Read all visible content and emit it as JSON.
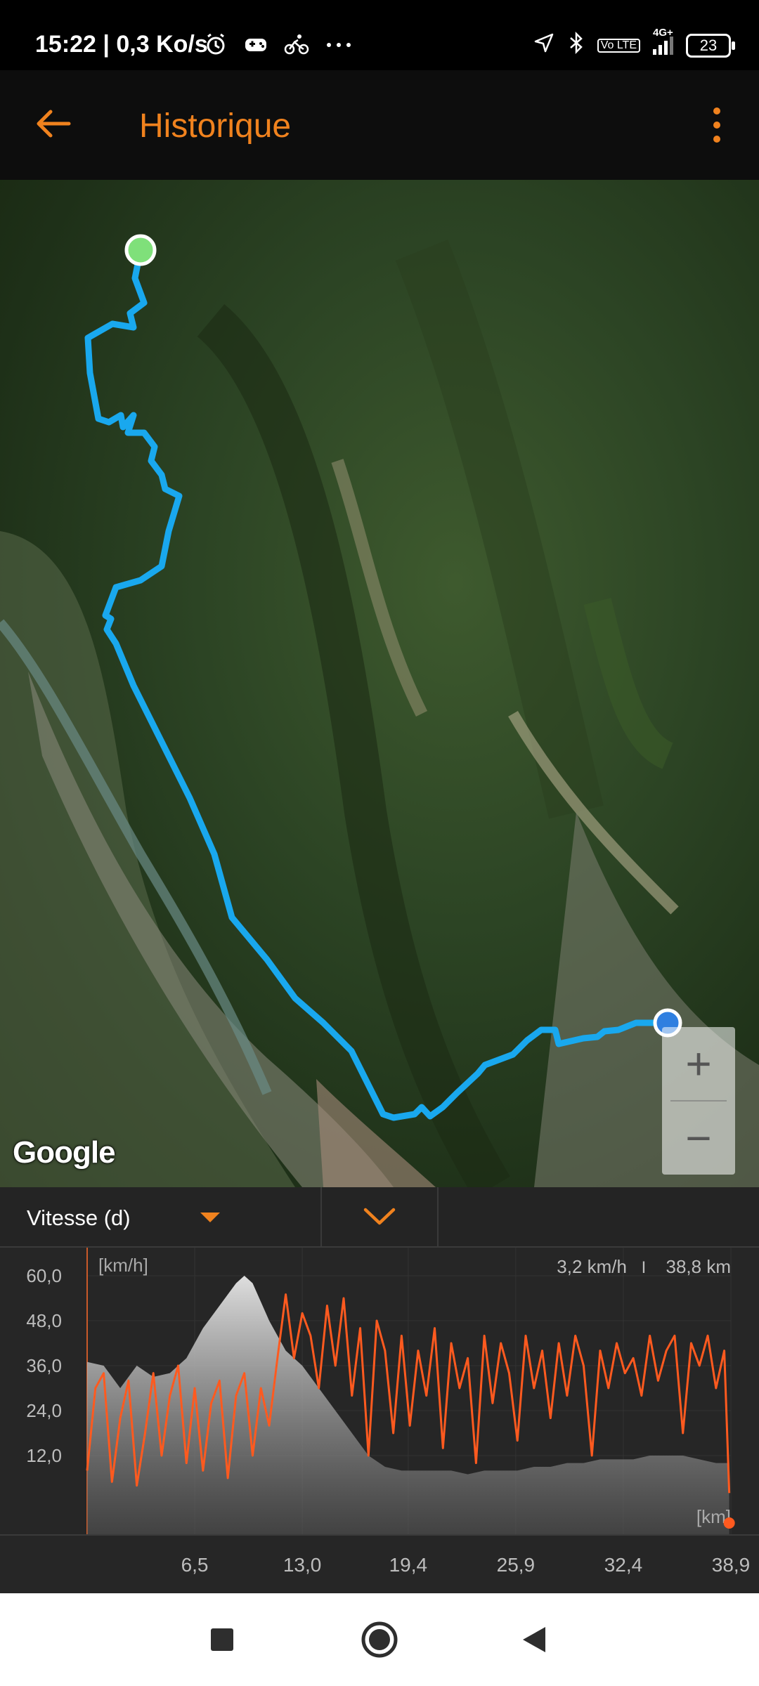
{
  "status_bar": {
    "time": "15:22 | 0,3 Ko/s",
    "network": "4G+",
    "volte": "Vo LTE",
    "battery": "23",
    "icons_left": [
      "alarm-icon",
      "gamepad-icon",
      "cycling-icon",
      "more-dots-icon"
    ],
    "icons_right": [
      "location-arrow-icon",
      "bluetooth-icon",
      "volte-icon",
      "signal-icon",
      "battery-icon"
    ]
  },
  "appbar": {
    "title": "Historique",
    "accent_color": "#f0821e"
  },
  "map": {
    "attribution": "Google",
    "route_color": "#19a8ee",
    "start_marker_color": "#7fe07a",
    "end_marker_color": "#2f7fe0",
    "zoom_in": "+",
    "zoom_out": "−"
  },
  "selector": {
    "metric": "Vitesse (d)"
  },
  "chart_data": {
    "type": "line",
    "ylabel": "[km/h]",
    "xlabel": "[km]",
    "summary_speed": "3,2 km/h",
    "summary_sep": "I",
    "summary_distance": "38,8 km",
    "yticks": [
      "60,0",
      "48,0",
      "36,0",
      "24,0",
      "12,0"
    ],
    "xticks": [
      "6,5",
      "13,0",
      "19,4",
      "25,9",
      "32,4",
      "38,9"
    ],
    "xlim": [
      0,
      38.9
    ],
    "ylim": [
      0,
      60
    ],
    "series": [
      {
        "name": "Vitesse",
        "color": "#ff5a1f",
        "x": [
          0,
          0.5,
          1,
          1.5,
          2,
          2.5,
          3,
          3.5,
          4,
          4.5,
          5,
          5.5,
          6,
          6.5,
          7,
          7.5,
          8,
          8.5,
          9,
          9.5,
          10,
          10.5,
          11,
          11.5,
          12,
          12.5,
          13,
          13.5,
          14,
          14.5,
          15,
          15.5,
          16,
          16.5,
          17,
          17.5,
          18,
          18.5,
          19,
          19.5,
          20,
          20.5,
          21,
          21.5,
          22,
          22.5,
          23,
          23.5,
          24,
          24.5,
          25,
          25.5,
          26,
          26.5,
          27,
          27.5,
          28,
          28.5,
          29,
          29.5,
          30,
          30.5,
          31,
          31.5,
          32,
          32.5,
          33,
          33.5,
          34,
          34.5,
          35,
          35.5,
          36,
          36.5,
          37,
          37.5,
          38,
          38.5,
          38.8
        ],
        "values": [
          8,
          30,
          34,
          5,
          22,
          32,
          4,
          18,
          34,
          12,
          28,
          36,
          10,
          30,
          8,
          26,
          32,
          6,
          28,
          34,
          12,
          30,
          20,
          38,
          55,
          38,
          50,
          44,
          30,
          52,
          36,
          54,
          28,
          46,
          12,
          48,
          40,
          18,
          44,
          20,
          40,
          28,
          46,
          14,
          42,
          30,
          38,
          10,
          44,
          26,
          42,
          34,
          16,
          44,
          30,
          40,
          22,
          42,
          28,
          44,
          36,
          12,
          40,
          30,
          42,
          34,
          38,
          28,
          44,
          32,
          40,
          44,
          18,
          42,
          36,
          44,
          30,
          40,
          2
        ]
      },
      {
        "name": "Altitude",
        "color": "#cfcfcf",
        "x": [
          0,
          1,
          2,
          3,
          4,
          5,
          6,
          7,
          8,
          9,
          9.5,
          10,
          11,
          12,
          13,
          14,
          15,
          16,
          17,
          18,
          19,
          20,
          21,
          22,
          23,
          24,
          25,
          26,
          27,
          28,
          29,
          30,
          31,
          32,
          33,
          34,
          35,
          36,
          37,
          38,
          38.8
        ],
        "values": [
          37,
          36,
          30,
          36,
          33,
          34,
          38,
          46,
          52,
          58,
          60,
          58,
          48,
          40,
          36,
          30,
          24,
          18,
          12,
          9,
          8,
          8,
          8,
          8,
          7,
          8,
          8,
          8,
          9,
          9,
          10,
          10,
          11,
          11,
          11,
          12,
          12,
          12,
          11,
          10,
          10
        ]
      }
    ],
    "grid": true,
    "end_marker_color": "#ff5a1f"
  },
  "navbar": {
    "icons": [
      "recent-apps-icon",
      "home-icon",
      "back-nav-icon"
    ]
  }
}
